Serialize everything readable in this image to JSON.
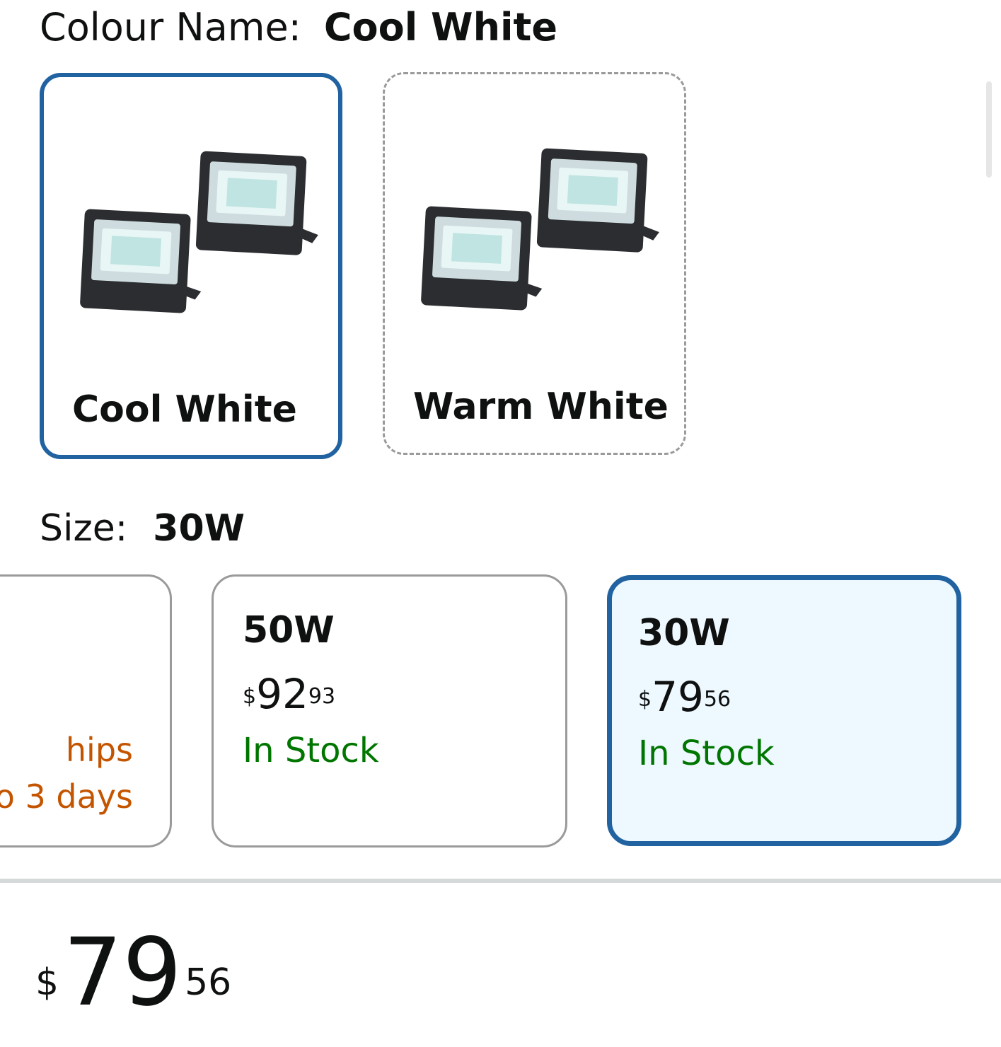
{
  "colour": {
    "label": "Colour Name:",
    "selected": "Cool White",
    "options": [
      {
        "label": "Cool White",
        "image": "twin-floodlight-image",
        "state": "selected"
      },
      {
        "label": "Warm White",
        "image": "twin-floodlight-image",
        "state": "available"
      }
    ]
  },
  "size": {
    "label": "Size:",
    "selected": "30W",
    "options": [
      {
        "ship_line1": "hips",
        "ship_line2": "o 3 days"
      },
      {
        "title": "50W",
        "price_symbol": "$",
        "price_whole": "92",
        "price_fraction": "93",
        "stock": "In Stock"
      },
      {
        "title": "30W",
        "price_symbol": "$",
        "price_whole": "79",
        "price_fraction": "56",
        "stock": "In Stock"
      }
    ]
  },
  "price": {
    "symbol": "$",
    "whole": "79",
    "fraction": "56"
  },
  "colors": {
    "accent": "#2162a1",
    "stock": "#007600",
    "shipping": "#c45500",
    "selected_bg": "#edf8ff"
  }
}
